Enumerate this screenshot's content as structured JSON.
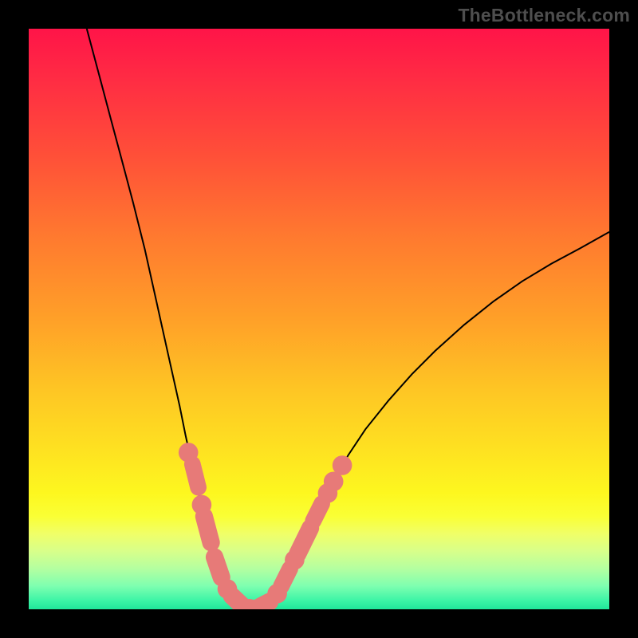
{
  "watermark": "TheBottleneck.com",
  "colors": {
    "marker": "#e77a78",
    "curve": "#000000",
    "gradient_top": "#ff1448",
    "gradient_bottom": "#20e69a"
  },
  "chart_data": {
    "type": "line",
    "title": "",
    "xlabel": "",
    "ylabel": "",
    "xlim": [
      0,
      100
    ],
    "ylim": [
      0,
      100
    ],
    "curve_points": [
      {
        "x": 10.0,
        "y": 100.0
      },
      {
        "x": 12.0,
        "y": 92.5
      },
      {
        "x": 14.0,
        "y": 85.0
      },
      {
        "x": 16.0,
        "y": 77.5
      },
      {
        "x": 18.0,
        "y": 70.0
      },
      {
        "x": 20.0,
        "y": 62.0
      },
      {
        "x": 22.0,
        "y": 53.0
      },
      {
        "x": 24.0,
        "y": 44.0
      },
      {
        "x": 26.0,
        "y": 35.0
      },
      {
        "x": 27.0,
        "y": 30.0
      },
      {
        "x": 28.0,
        "y": 25.5
      },
      {
        "x": 29.0,
        "y": 21.0
      },
      {
        "x": 30.0,
        "y": 17.0
      },
      {
        "x": 31.0,
        "y": 13.0
      },
      {
        "x": 32.0,
        "y": 9.5
      },
      {
        "x": 33.0,
        "y": 6.5
      },
      {
        "x": 34.0,
        "y": 4.0
      },
      {
        "x": 35.0,
        "y": 2.2
      },
      {
        "x": 36.0,
        "y": 1.0
      },
      {
        "x": 37.0,
        "y": 0.3
      },
      {
        "x": 38.0,
        "y": 0.0
      },
      {
        "x": 39.0,
        "y": 0.0
      },
      {
        "x": 40.0,
        "y": 0.3
      },
      {
        "x": 41.0,
        "y": 1.0
      },
      {
        "x": 42.0,
        "y": 2.0
      },
      {
        "x": 43.0,
        "y": 3.3
      },
      {
        "x": 44.0,
        "y": 5.0
      },
      {
        "x": 45.0,
        "y": 6.8
      },
      {
        "x": 46.0,
        "y": 8.8
      },
      {
        "x": 48.0,
        "y": 13.0
      },
      {
        "x": 50.0,
        "y": 17.2
      },
      {
        "x": 52.0,
        "y": 21.2
      },
      {
        "x": 55.0,
        "y": 26.5
      },
      {
        "x": 58.0,
        "y": 31.0
      },
      {
        "x": 62.0,
        "y": 36.0
      },
      {
        "x": 66.0,
        "y": 40.5
      },
      {
        "x": 70.0,
        "y": 44.5
      },
      {
        "x": 75.0,
        "y": 49.0
      },
      {
        "x": 80.0,
        "y": 53.0
      },
      {
        "x": 85.0,
        "y": 56.5
      },
      {
        "x": 90.0,
        "y": 59.5
      },
      {
        "x": 95.0,
        "y": 62.2
      },
      {
        "x": 100.0,
        "y": 65.0
      }
    ],
    "markers": [
      {
        "shape": "dot",
        "x": 27.5,
        "y": 27.0,
        "r": 1.0
      },
      {
        "shape": "pill",
        "x1": 28.2,
        "y1": 25.0,
        "x2": 29.2,
        "y2": 21.0,
        "w": 1.2
      },
      {
        "shape": "dot",
        "x": 29.8,
        "y": 18.0,
        "r": 1.0
      },
      {
        "shape": "pill",
        "x1": 30.2,
        "y1": 16.0,
        "x2": 31.4,
        "y2": 11.5,
        "w": 1.4
      },
      {
        "shape": "pill",
        "x1": 32.0,
        "y1": 9.0,
        "x2": 33.2,
        "y2": 5.5,
        "w": 1.4
      },
      {
        "shape": "dot",
        "x": 34.2,
        "y": 3.5,
        "r": 1.0
      },
      {
        "shape": "pill",
        "x1": 35.0,
        "y1": 2.3,
        "x2": 37.0,
        "y2": 0.4,
        "w": 1.4
      },
      {
        "shape": "dot",
        "x": 38.0,
        "y": 0.1,
        "r": 1.0
      },
      {
        "shape": "pill",
        "x1": 39.0,
        "y1": 0.0,
        "x2": 41.5,
        "y2": 1.3,
        "w": 1.4
      },
      {
        "shape": "dot",
        "x": 42.8,
        "y": 2.7,
        "r": 1.0
      },
      {
        "shape": "pill",
        "x1": 43.5,
        "y1": 4.0,
        "x2": 45.0,
        "y2": 7.0,
        "w": 1.2
      },
      {
        "shape": "dot",
        "x": 45.8,
        "y": 8.5,
        "r": 1.0
      },
      {
        "shape": "pill",
        "x1": 46.3,
        "y1": 9.5,
        "x2": 48.5,
        "y2": 14.0,
        "w": 1.4
      },
      {
        "shape": "pill",
        "x1": 49.0,
        "y1": 15.2,
        "x2": 50.5,
        "y2": 18.2,
        "w": 1.2
      },
      {
        "shape": "dot",
        "x": 51.5,
        "y": 20.0,
        "r": 1.0
      },
      {
        "shape": "dot",
        "x": 52.5,
        "y": 22.0,
        "r": 1.0
      },
      {
        "shape": "dot",
        "x": 54.0,
        "y": 24.8,
        "r": 1.0
      }
    ]
  }
}
